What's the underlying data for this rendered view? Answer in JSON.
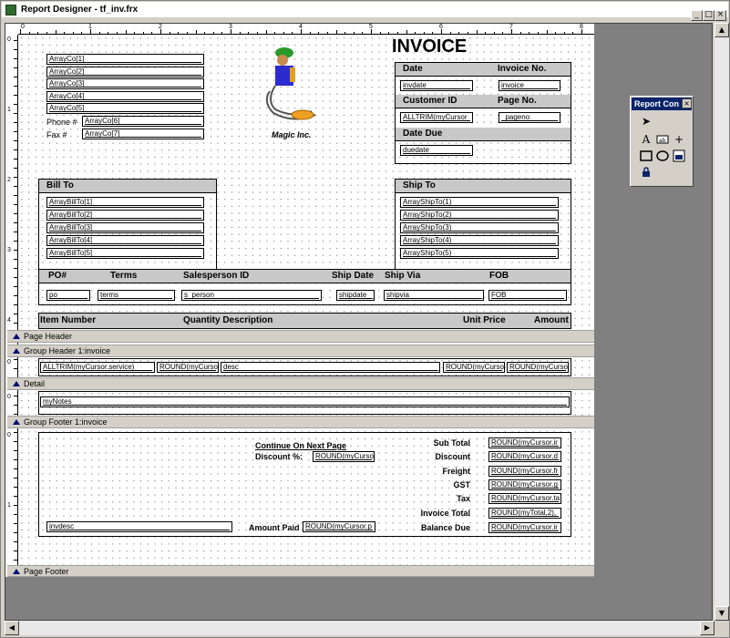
{
  "window": {
    "title": "Report Designer - tf_inv.frx"
  },
  "caption_buttons": {
    "minimize": "_",
    "maximize": "□",
    "close": "×"
  },
  "ruler": {
    "h": [
      "0",
      "1",
      "2",
      "3",
      "4",
      "5",
      "6",
      "7",
      "8"
    ],
    "v": [
      "0",
      "1",
      "2",
      "3",
      "4"
    ],
    "v2": [
      "0"
    ],
    "v3": [
      "0"
    ],
    "v4": [
      "0",
      "1"
    ]
  },
  "header": {
    "company": [
      "ArrayCo[1]_____________________",
      "ArrayCo[2]_____________________",
      "ArrayCo[3]_____________________",
      "ArrayCo[4]_____________________",
      "ArrayCo[5]_____________________"
    ],
    "phone_label": "Phone #",
    "phone_field": "ArrayCo[6]______________",
    "fax_label": "Fax #",
    "fax_field": "ArrayCo[7]______________",
    "logo_caption": "Magic Inc.",
    "invoice_title": "INVOICE",
    "date_label": "Date",
    "invoice_no_label": "Invoice No.",
    "invdate": "invdate__________",
    "invoice": "invoice_______",
    "customer_id_label": "Customer ID",
    "page_no_label": "Page No.",
    "customer_field": "ALLTRIM(myCursor",
    "pageno": "_pageno_______",
    "date_due_label": "Date Due",
    "duedate": "duedate__________",
    "bill_to": "Bill To",
    "bill_fields": [
      "ArrayBillTo[1]____________________",
      "ArrayBillTo[2]____________________",
      "ArrayBillTo[3]____________________",
      "ArrayBillTo[4]____________________",
      "ArrayBillTo[5]____________________"
    ],
    "ship_to": "Ship To",
    "ship_fields": [
      "ArrayShipTo(1)____________________",
      "ArrayShipTo(2)____________________",
      "ArrayShipTo(3)____________________",
      "ArrayShipTo(4)____________________",
      "ArrayShipTo(5)____________________"
    ],
    "po_label": "PO#",
    "terms_label": "Terms",
    "salesperson_label": "Salesperson ID",
    "ship_date_label": "Ship Date",
    "ship_via_label": "Ship Via",
    "fob_label": "FOB",
    "po": "po_______",
    "terms": "terms____________",
    "s_person": "s_person_______________________",
    "shipdate": "shipdate_____",
    "shipvia": "shipvia____________________",
    "fob": "FOB______________",
    "item_number": "Item Number",
    "quantity_description": "Quantity Description",
    "unit_price": "Unit Price",
    "amount": "Amount"
  },
  "bands": {
    "page_header": "Page Header",
    "group_header": "Group Header 1:invoice",
    "detail": "Detail",
    "group_footer": "Group Footer 1:invoice",
    "page_footer": "Page Footer"
  },
  "group_header_fields": [
    "ALLTRIM(myCursor.service)____",
    "ROUND(myCurso",
    "desc_____________________________________________________",
    "ROUND(myCurso",
    "ROUND(myCurso"
  ],
  "detail_field": "myNotes______________________________________________________________________________",
  "footer": {
    "continue": "Continue On Next Page",
    "discount_pct": "Discount %:",
    "discount_field": "ROUND(myCurso",
    "invdesc": "invdesc______________________________",
    "amount_paid": "Amount Paid",
    "amount_paid_field": "ROUND(myCursor.p",
    "totals_labels": [
      "Sub Total",
      "Discount",
      "Freight",
      "GST",
      "Tax",
      "Invoice Total",
      "Balance Due"
    ],
    "totals_fields": [
      "ROUND(myCursor.ir",
      "ROUND(myCursor.d",
      "ROUND(myCursor.fr",
      "ROUND(myCursor.g",
      "ROUND(myCursor.ta",
      "ROUND(myTotal,2),",
      "ROUND(myCursor.ir"
    ]
  },
  "toolbox": {
    "title": "Report Con",
    "close": "×"
  },
  "colors": {
    "band_bar": "#d4d0c8",
    "header_box": "#c8c8c8",
    "canvas": "#ffffff",
    "background": "#808080"
  }
}
